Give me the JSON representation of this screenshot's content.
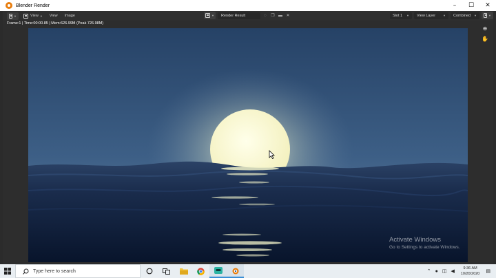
{
  "window": {
    "title": "Blender Render",
    "controls": [
      "–",
      "☐",
      "✕"
    ]
  },
  "header": {
    "menus": [
      "View",
      "View",
      "Image"
    ],
    "image_name": "Render Result",
    "slot": "Slot 1",
    "layer": "View Layer",
    "pass": "Combined"
  },
  "viewer": {
    "stats": "Frame:1 | Time:00:00.85 | Mem:626.99M (Peak 726.98M)",
    "render_description_colors": {
      "sky_top": "#2a4a70",
      "sky_horizon": "#6a86a8",
      "moon": "#fdfbd6",
      "sea": "#0b1830"
    }
  },
  "watermark": {
    "line1": "Activate Windows",
    "line2": "Go to Settings to activate Windows."
  },
  "taskbar": {
    "search_placeholder": "Type here to search",
    "time": "9:36 AM",
    "date": "10/20/2020"
  }
}
